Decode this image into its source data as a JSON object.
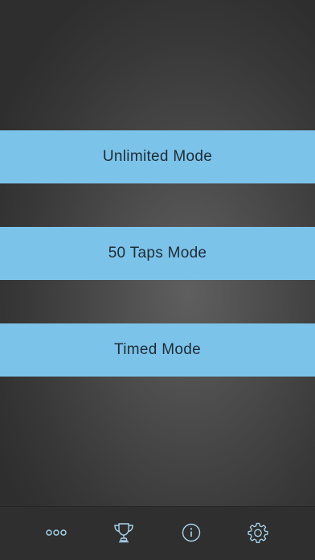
{
  "modes": [
    {
      "label": "Unlimited Mode"
    },
    {
      "label": "50 Taps Mode"
    },
    {
      "label": "Timed Mode"
    }
  ],
  "tabbar": {
    "items": [
      {
        "icon": "more-icon"
      },
      {
        "icon": "trophy-icon"
      },
      {
        "icon": "info-icon"
      },
      {
        "icon": "gear-icon"
      }
    ]
  },
  "colors": {
    "button_bg": "#7cc3ea",
    "button_text": "#1e2c36",
    "tabbar_bg": "#2f2f2f",
    "icon": "#a9d6ef"
  }
}
